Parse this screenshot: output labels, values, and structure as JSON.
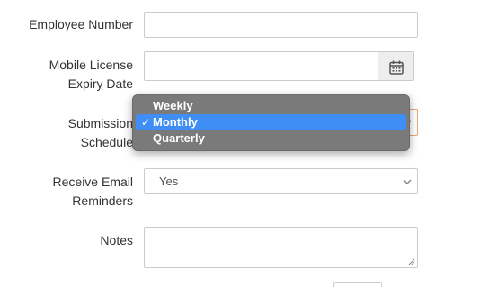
{
  "form": {
    "employee_number": {
      "label": "Employee Number",
      "value": ""
    },
    "mobile_license": {
      "label_line1": "Mobile License",
      "label_line2": "Expiry Date",
      "value": ""
    },
    "submission": {
      "label_line1": "Submission",
      "label_line2": "Schedule",
      "options": [
        "Weekly",
        "Monthly",
        "Quarterly"
      ],
      "selected": "Monthly",
      "check_glyph": "✓"
    },
    "email_reminders": {
      "label_line1": "Receive Email",
      "label_line2": "Reminders",
      "value": "Yes"
    },
    "notes": {
      "label": "Notes",
      "value": ""
    }
  },
  "colors": {
    "field_border": "#cccccc",
    "dropdown_bg": "#7a7a7a",
    "dropdown_highlight": "#3f8ef6",
    "focus_border": "#e8a878"
  },
  "icons": [
    "calendar-icon",
    "chevron-down-icon",
    "resize-grip-icon",
    "checkmark-icon"
  ]
}
